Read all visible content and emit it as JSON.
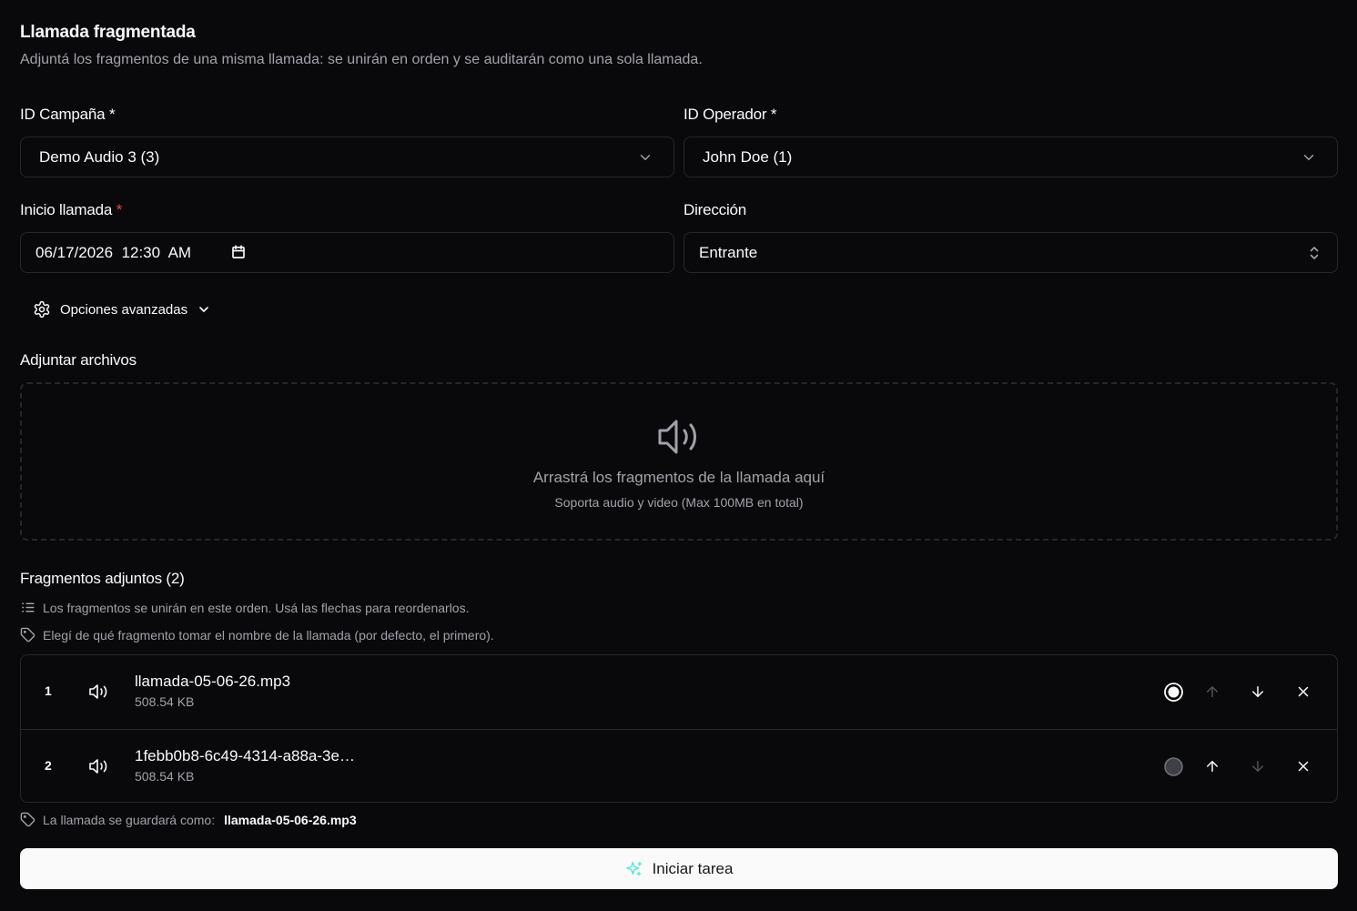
{
  "header": {
    "title": "Llamada fragmentada",
    "subtitle": "Adjuntá los fragmentos de una misma llamada: se unirán en orden y se auditarán como una sola llamada."
  },
  "form": {
    "campaign": {
      "label": "ID Campaña",
      "required_mark": "*",
      "value": "Demo Audio 3 (3)"
    },
    "operator": {
      "label": "ID Operador",
      "required_mark": "*",
      "value": "John Doe (1)"
    },
    "start": {
      "label": "Inicio llamada",
      "required_mark": "*",
      "value": "06/17/2026  12:30  AM"
    },
    "direction": {
      "label": "Dirección",
      "value": "Entrante"
    }
  },
  "advanced": {
    "label": "Opciones avanzadas"
  },
  "attach": {
    "title": "Adjuntar archivos",
    "drop_text": "Arrastrá los fragmentos de la llamada aquí",
    "drop_hint": "Soporta audio y video (Max 100MB en total)"
  },
  "fragments": {
    "title": "Fragmentos adjuntos (2)",
    "order_hint": "Los fragmentos se unirán en este orden. Usá las flechas para reordenarlos.",
    "name_hint": "Elegí de qué fragmento tomar el nombre de la llamada (por defecto, el primero).",
    "items": [
      {
        "index": "1",
        "name": "llamada-05-06-26.mp3",
        "size": "508.54 KB",
        "selected": true
      },
      {
        "index": "2",
        "name": "1febb0b8-6c49-4314-a88a-3e…",
        "size": "508.54 KB",
        "selected": false
      }
    ],
    "save_prefix": "La llamada se guardará como:",
    "save_name": "llamada-05-06-26.mp3"
  },
  "actions": {
    "start_label": "Iniciar tarea"
  },
  "colors": {
    "background": "#09090b",
    "border": "#27272a",
    "muted_text": "#a1a1aa",
    "required_red": "#ef4444",
    "button_bg": "#fafafa",
    "sparkle_accent": "#5eead4"
  }
}
